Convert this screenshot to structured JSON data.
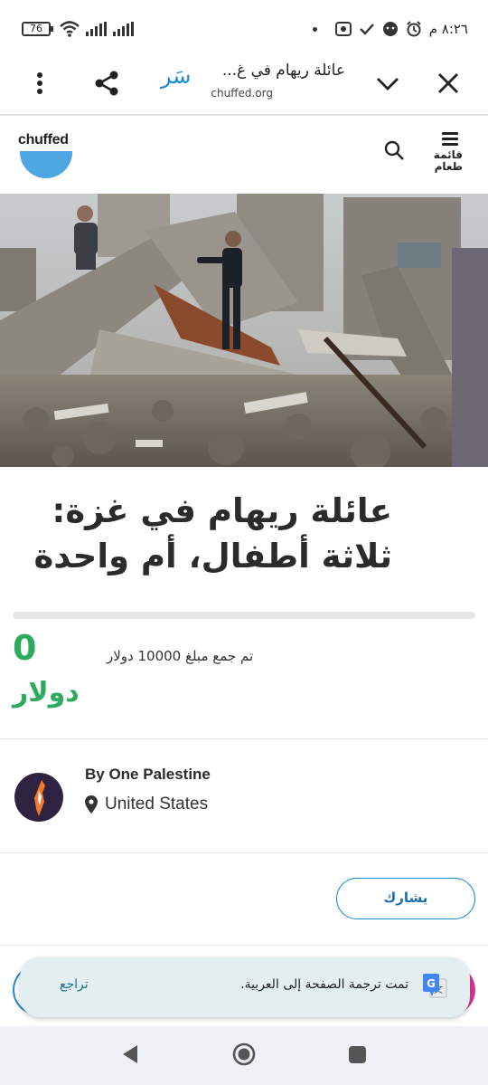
{
  "status_bar": {
    "battery": "76",
    "time": "٨:٢٦ م"
  },
  "browser": {
    "page_title": "عائلة ريهام في غ...",
    "url": "chuffed.org",
    "site_logo": "سَر"
  },
  "site_header": {
    "brand": "chuffed",
    "menu_label": "قائمة طعام"
  },
  "campaign": {
    "title": "عائلة ريهام في غزة: ثلاثة أطفال، أم واحدة",
    "raised_amount": "0",
    "raised_currency": "دولار",
    "goal_text": "تم جمع مبلغ 10000 دولار",
    "progress_fraction": 0
  },
  "organizer": {
    "name": "By One Palestine",
    "location": "United States"
  },
  "actions": {
    "share_label": "يشارك"
  },
  "translate_bar": {
    "message": "تمت ترجمة الصفحة إلى العربية.",
    "undo_label": "تراجع"
  },
  "colors": {
    "accent_blue": "#1a8bd6",
    "amount_green": "#2eaa5e",
    "brand_blue": "#4ea7e0"
  },
  "icons": [
    "wifi-icon",
    "signal-icon",
    "time-icon",
    "alarm-icon",
    "close-icon",
    "chevron-down-icon",
    "share-icon",
    "more-vert-icon",
    "search-icon",
    "menu-icon",
    "location-pin-icon",
    "google-translate-icon",
    "nav-back-icon",
    "nav-home-icon",
    "nav-recents-icon"
  ]
}
